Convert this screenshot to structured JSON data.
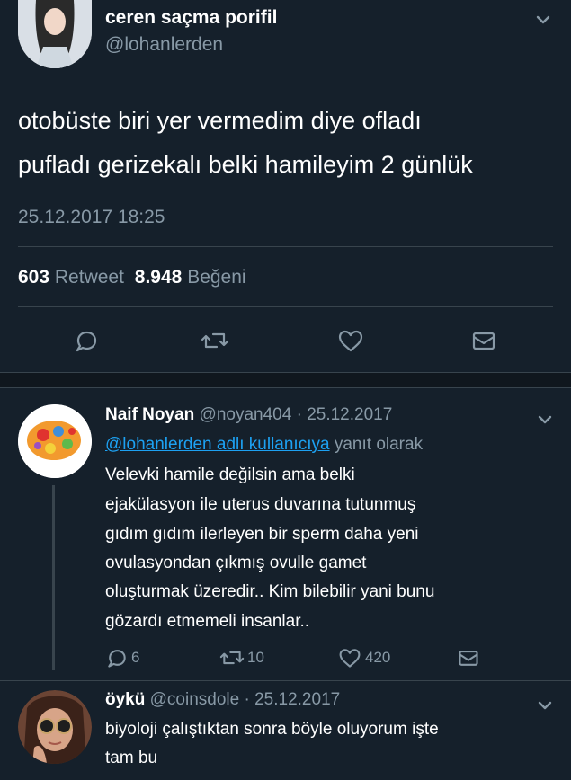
{
  "main_tweet": {
    "display_name": "ceren saçma porifil",
    "handle": "@lohanlerden",
    "text_line1": "otobüste biri yer vermedim diye ofladı",
    "text_line2": "pufladı gerizekalı belki hamileyim 2 günlük",
    "timestamp": "25.12.2017 18:25",
    "retweet_count": "603",
    "retweet_label": "Retweet",
    "like_count": "8.948",
    "like_label": "Beğeni"
  },
  "reply1": {
    "display_name": "Naif Noyan",
    "handle": "@noyan404",
    "separator": "·",
    "date": "25.12.2017",
    "reply_to_mention": "@lohanlerden adlı kullanıcıya",
    "reply_to_suffix": "yanıt olarak",
    "lines": [
      "Velevki hamile değilsin ama belki",
      "ejakülasyon ile uterus duvarına tutunmuş",
      "gıdım gıdım ilerleyen bir sperm daha yeni",
      "ovulasyondan çıkmış ovulle gamet",
      "oluşturmak üzeredir.. Kim bilebilir yani bunu",
      "gözardı etmemeli insanlar.."
    ],
    "reply_count": "6",
    "retweet_count": "10",
    "like_count": "420"
  },
  "reply2": {
    "display_name": "öykü",
    "handle": "@coinsdole",
    "separator": "·",
    "date": "25.12.2017",
    "line1": "biyoloji çalıştıktan sonra böyle oluyorum işte",
    "line2": "tam bu"
  },
  "colors": {
    "background": "#15202b",
    "muted": "#8899a6",
    "link": "#1da1f2",
    "divider": "#38444d",
    "section_gap": "#10171e"
  },
  "icons": [
    "chevron-down-icon",
    "reply-icon",
    "retweet-icon",
    "like-icon",
    "direct-message-icon"
  ]
}
